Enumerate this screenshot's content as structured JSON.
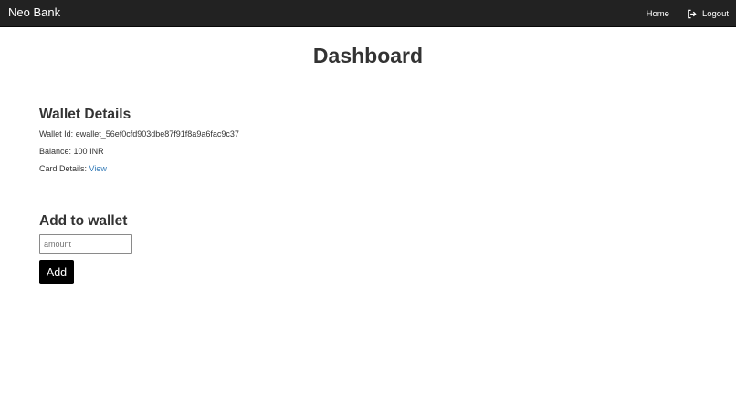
{
  "navbar": {
    "brand": "Neo Bank",
    "home_label": "Home",
    "logout_label": "Logout",
    "logout_icon": "sign-out-icon",
    "background": "#222222"
  },
  "page": {
    "title": "Dashboard"
  },
  "wallet": {
    "heading": "Wallet Details",
    "wallet_id_label": "Wallet Id:",
    "wallet_id_value": "ewallet_56ef0cfd903dbe87f91f8a9a6fac9c37",
    "balance_label": "Balance:",
    "balance_value": "100 INR",
    "card_details_label": "Card Details:",
    "card_details_link": "View",
    "link_color": "#337ab7"
  },
  "add_wallet": {
    "heading": "Add to wallet",
    "amount_placeholder": "amount",
    "amount_value": "",
    "add_button_label": "Add"
  }
}
